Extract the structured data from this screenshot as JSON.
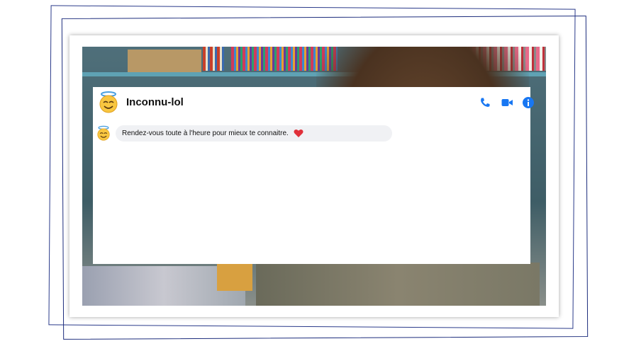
{
  "chat": {
    "contact_name": "Inconnu-lol",
    "avatar_icon": "smiling-face-with-halo-icon",
    "header_icons": [
      "phone-icon",
      "video-call-icon",
      "info-icon"
    ],
    "accent_color": "#1877f2",
    "messages": [
      {
        "text": "Rendez-vous toute à l'heure pour mieux te connaitre.",
        "reaction_icon": "heart-icon"
      }
    ]
  }
}
